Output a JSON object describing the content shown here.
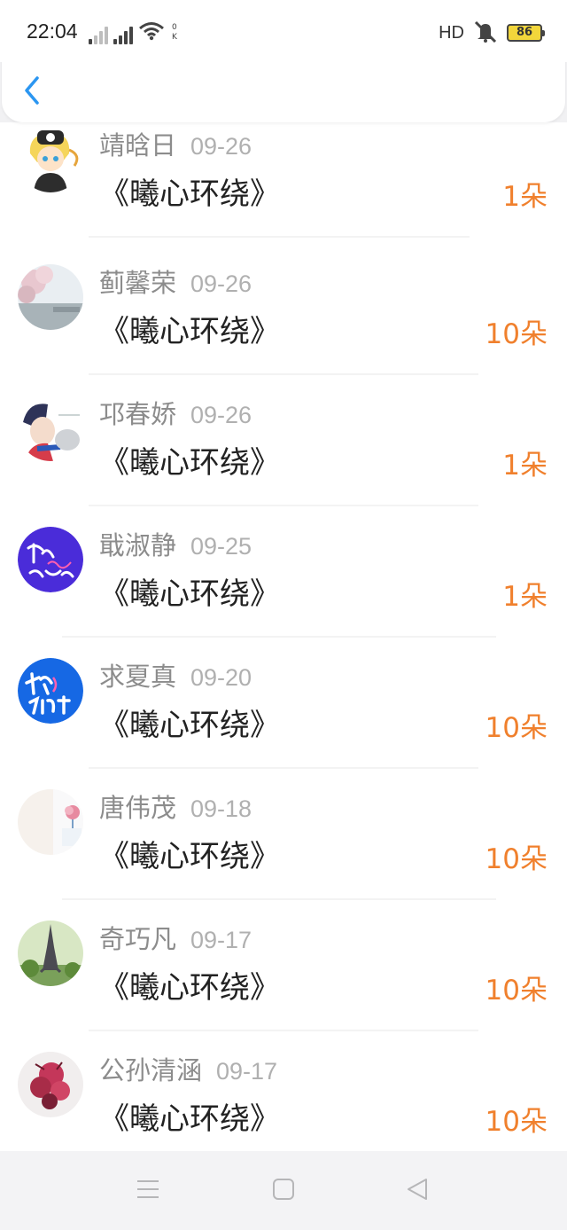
{
  "status_bar": {
    "time": "22:04",
    "network_type": "4G",
    "hd_label": "HD",
    "battery_level": "86"
  },
  "header": {
    "back_icon": "chevron-left-icon"
  },
  "colors": {
    "accent": "#2b96f1",
    "flower_count": "#f0802d"
  },
  "gifts": [
    {
      "name": "靖晗日",
      "date": "09-26",
      "title": "《曦心环绕》",
      "amount": "1朵"
    },
    {
      "name": "蓟馨荣",
      "date": "09-26",
      "title": "《曦心环绕》",
      "amount": "10朵"
    },
    {
      "name": "邛春娇",
      "date": "09-26",
      "title": "《曦心环绕》",
      "amount": "1朵"
    },
    {
      "name": "戢淑静",
      "date": "09-25",
      "title": "《曦心环绕》",
      "amount": "1朵"
    },
    {
      "name": "求夏真",
      "date": "09-20",
      "title": "《曦心环绕》",
      "amount": "10朵"
    },
    {
      "name": "唐伟茂",
      "date": "09-18",
      "title": "《曦心环绕》",
      "amount": "10朵"
    },
    {
      "name": "奇巧凡",
      "date": "09-17",
      "title": "《曦心环绕》",
      "amount": "10朵"
    },
    {
      "name": "公孙清涵",
      "date": "09-17",
      "title": "《曦心环绕》",
      "amount": "10朵"
    }
  ],
  "system_nav": {
    "menu_icon": "menu-icon",
    "home_icon": "home-square-icon",
    "back_icon": "back-triangle-icon"
  }
}
